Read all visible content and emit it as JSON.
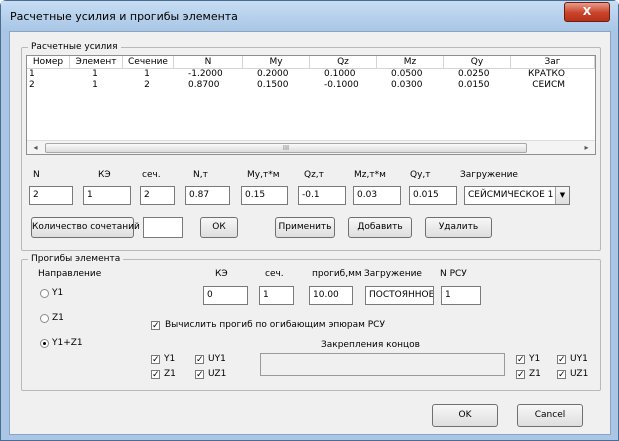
{
  "window": {
    "title": "Расчетные усилия и прогибы элемента",
    "close": "X"
  },
  "forces": {
    "legend": "Расчетные усилия",
    "columns": [
      "Номер",
      "Элемент",
      "Сечение",
      "N",
      "My",
      "Qz",
      "Mz",
      "Qy",
      "Заг"
    ],
    "rows": [
      [
        "1",
        "1",
        "1",
        "-1.2000",
        "0.2000",
        "0.1000",
        "0.0500",
        "0.0250",
        "КРАТКО"
      ],
      [
        "2",
        "1",
        "2",
        "0.8700",
        "0.1500",
        "-0.1000",
        "0.0300",
        "0.0150",
        "СЕЙСМ"
      ]
    ],
    "scroll_left": "◂",
    "scroll_right": "▸",
    "scroll_thumb": "III",
    "field_labels": {
      "n": "N",
      "ke": "КЭ",
      "sec": "сеч.",
      "nt": "N,т",
      "my": "My,т*м",
      "qz": "Qz,т",
      "mz": "Mz,т*м",
      "qy": "Qy,т",
      "load": "Загружение"
    },
    "fields": {
      "n": "2",
      "ke": "1",
      "sec": "2",
      "nt": "0.87",
      "my": "0.15",
      "qz": "-0.1",
      "mz": "0.03",
      "qy": "0.015",
      "load": "СЕЙСМИЧЕСКОЕ 1"
    },
    "combo_arrow": "▼",
    "combos_button": "Количество сочетаний",
    "combos_value": "",
    "ok_button": "ОК",
    "apply_button": "Применить",
    "add_button": "Добавить",
    "delete_button": "Удалить"
  },
  "deflection": {
    "legend": "Прогибы элемента",
    "direction_label": "Направление",
    "directions": [
      "Y1",
      "Z1",
      "Y1+Z1"
    ],
    "selected_direction": 2,
    "field_labels": {
      "ke": "КЭ",
      "sec": "сеч.",
      "defl": "прогиб,мм",
      "load": "Загружение",
      "nrsu": "N РСУ"
    },
    "fields": {
      "ke": "0",
      "sec": "1",
      "defl": "10.00",
      "load": "ПОСТОЯННОЕ",
      "nrsu": "1"
    },
    "envelope_check": "Вычислить прогиб по огибающим эпюрам РСУ",
    "fixings_label": "Закрепления концов",
    "check_mark": "✓",
    "left_end": {
      "y1": "Y1",
      "uy1": "UY1",
      "z1": "Z1",
      "uz1": "UZ1"
    },
    "right_end": {
      "y1": "Y1",
      "uy1": "UY1",
      "z1": "Z1",
      "uz1": "UZ1"
    }
  },
  "dialog": {
    "ok": "OK",
    "cancel": "Cancel"
  }
}
